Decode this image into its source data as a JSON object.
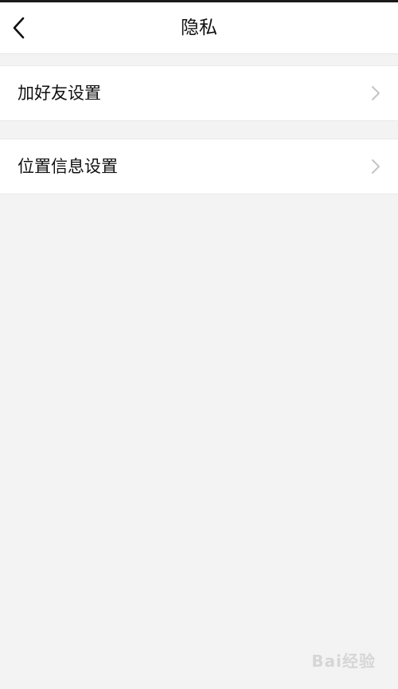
{
  "header": {
    "title": "隐私",
    "back_icon": "chevron-left-icon"
  },
  "settings": [
    {
      "label": "加好友设置",
      "icon": "chevron-right-icon"
    },
    {
      "label": "位置信息设置",
      "icon": "chevron-right-icon"
    }
  ],
  "watermark": {
    "text": "Bai经验"
  },
  "colors": {
    "background": "#f3f3f3",
    "surface": "#ffffff",
    "text": "#111111",
    "chevron": "#c4c4c4"
  }
}
